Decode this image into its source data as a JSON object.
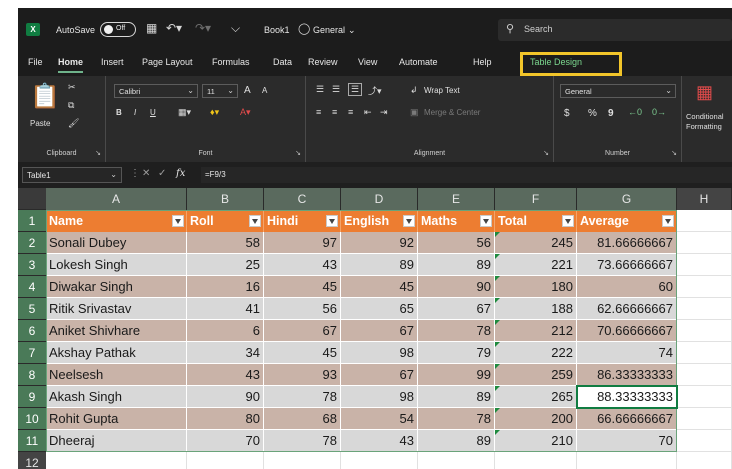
{
  "titlebar": {
    "autosave_label": "AutoSave",
    "toggle_state": "Off",
    "workbook_name": "Book1",
    "sensitivity_label": "General",
    "search_placeholder": "Search"
  },
  "tabs": [
    "File",
    "Home",
    "Insert",
    "Page Layout",
    "Formulas",
    "Data",
    "Review",
    "View",
    "Automate",
    "Help",
    "Table Design"
  ],
  "active_tab": "Home",
  "ribbon": {
    "clipboard": {
      "paste_label": "Paste",
      "group_label": "Clipboard"
    },
    "font": {
      "font_name": "Calibri",
      "font_size": "11",
      "grow": "A",
      "shrink": "A",
      "bold": "B",
      "italic": "I",
      "underline": "U",
      "group_label": "Font"
    },
    "alignment": {
      "wrap_text": "Wrap Text",
      "merge_center": "Merge & Center",
      "group_label": "Alignment"
    },
    "number": {
      "format": "General",
      "currency": "$",
      "percent": "%",
      "comma": "9",
      "group_label": "Number"
    },
    "styles": {
      "conditional_line1": "Conditional",
      "conditional_line2": "Formatting"
    }
  },
  "formula_bar": {
    "name_box": "Table1",
    "fx": "fx",
    "formula": "=F9/3"
  },
  "sheet": {
    "column_letters": [
      "A",
      "B",
      "C",
      "D",
      "E",
      "F",
      "G",
      "H"
    ],
    "row_numbers": [
      "1",
      "2",
      "3",
      "4",
      "5",
      "6",
      "7",
      "8",
      "9",
      "10",
      "11",
      "12"
    ],
    "headers": [
      "Name",
      "Roll",
      "Hindi",
      "English",
      "Maths",
      "Total",
      "Average"
    ],
    "rows": [
      [
        "Sonali Dubey",
        "58",
        "97",
        "92",
        "56",
        "245",
        "81.66666667"
      ],
      [
        "Lokesh Singh",
        "25",
        "43",
        "89",
        "89",
        "221",
        "73.66666667"
      ],
      [
        "Diwakar Singh",
        "16",
        "45",
        "45",
        "90",
        "180",
        "60"
      ],
      [
        "Ritik Srivastav",
        "41",
        "56",
        "65",
        "67",
        "188",
        "62.66666667"
      ],
      [
        "Aniket Shivhare",
        "6",
        "67",
        "67",
        "78",
        "212",
        "70.66666667"
      ],
      [
        "Akshay Pathak",
        "34",
        "45",
        "98",
        "79",
        "222",
        "74"
      ],
      [
        "Neelsesh",
        "43",
        "93",
        "67",
        "99",
        "259",
        "86.33333333"
      ],
      [
        "Akash Singh",
        "90",
        "78",
        "98",
        "89",
        "265",
        "88.33333333"
      ],
      [
        "Rohit Gupta",
        "80",
        "68",
        "54",
        "78",
        "200",
        "66.66666667"
      ],
      [
        "Dheeraj",
        "70",
        "78",
        "43",
        "89",
        "210",
        "70"
      ]
    ],
    "selected_cell": "G9",
    "colors": {
      "header_fill": "#ed7d31",
      "band_dark": "#c9b3a8",
      "band_light": "#d8d8d8",
      "selection": "#107c41"
    }
  }
}
